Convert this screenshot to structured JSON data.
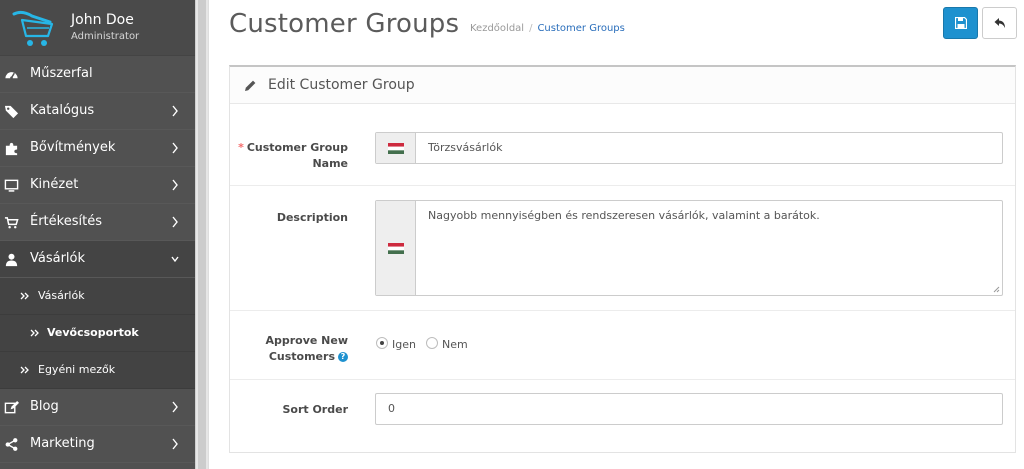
{
  "user": {
    "name": "John Doe",
    "role": "Administrator"
  },
  "nav": {
    "items": [
      {
        "label": "Műszerfal"
      },
      {
        "label": "Katalógus"
      },
      {
        "label": "Bővítmények"
      },
      {
        "label": "Kinézet"
      },
      {
        "label": "Értékesítés"
      },
      {
        "label": "Vásárlók"
      },
      {
        "label": "Blog"
      },
      {
        "label": "Marketing"
      }
    ],
    "sub_items": [
      {
        "label": "Vásárlók"
      },
      {
        "label": "Vevőcsoportok"
      },
      {
        "label": "Egyéni mezők"
      }
    ]
  },
  "page": {
    "title": "Customer Groups",
    "breadcrumb": {
      "home": "Kezdőoldal",
      "separator": "/",
      "current": "Customer Groups"
    }
  },
  "panel": {
    "title": "Edit Customer Group"
  },
  "form": {
    "name": {
      "required_mark": "*",
      "label_line1": "Customer Group",
      "label_line2": "Name",
      "value": "Törzsvásárlók"
    },
    "description": {
      "label": "Description",
      "value": "Nagyobb mennyiségben és rendszeresen vásárlók, valamint a barátok."
    },
    "approve": {
      "label_line1": "Approve New",
      "label_line2": "Customers",
      "help": "?",
      "options": [
        {
          "label": "Igen",
          "checked": true
        },
        {
          "label": "Nem",
          "checked": false
        }
      ]
    },
    "sort_order": {
      "label": "Sort Order",
      "value": "0"
    }
  },
  "colors": {
    "sidebar_bg": "#515151",
    "primary": "#1e91cf",
    "breadcrumb_link": "#2a6ebb",
    "required": "#f56b6b"
  },
  "icons": {
    "logo": "cart-logo-icon",
    "nav": [
      "dashboard-icon",
      "tags-icon",
      "puzzle-icon",
      "desktop-icon",
      "shopping-cart-icon",
      "user-icon",
      "edit-icon",
      "share-icon"
    ],
    "save": "floppy-disk-icon",
    "back": "reply-icon",
    "panel": "pencil-icon",
    "flag": "hungary-flag-icon"
  }
}
